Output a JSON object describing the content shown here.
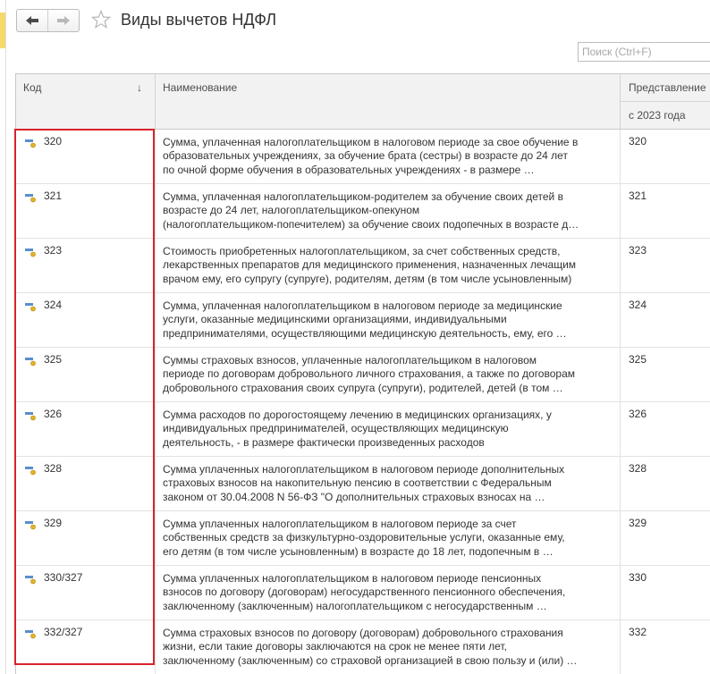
{
  "header": {
    "title": "Виды вычетов НДФЛ",
    "back_icon": "arrow-left-icon",
    "forward_icon": "arrow-right-icon",
    "favorite_icon": "star-icon"
  },
  "search": {
    "placeholder": "Поиск (Ctrl+F)",
    "value": ""
  },
  "table": {
    "columns": {
      "code": "Код",
      "name": "Наименование",
      "representation": "Представление",
      "representation_sub": "с 2023 года"
    },
    "sort_indicator": "↓",
    "rows": [
      {
        "code": "320",
        "name": "Сумма, уплаченная налогоплательщиком в налоговом периоде за свое обучение в\nобразовательных учреждениях, за обучение брата (сестры) в возрасте до 24 лет\nпо очной форме обучения в образовательных учреждениях - в размере …",
        "rep": "320"
      },
      {
        "code": "321",
        "name": "Сумма, уплаченная налогоплательщиком-родителем за обучение своих детей в\nвозрасте до 24 лет, налогоплательщиком-опекуном\n(налогоплательщиком-попечителем) за обучение своих подопечных в возрасте д…",
        "rep": "321"
      },
      {
        "code": "323",
        "name": "Стоимость приобретенных налогоплательщиком, за счет собственных средств,\nлекарственных препаратов для медицинского применения, назначенных лечащим\nврачом ему, его супругу (супруге), родителям, детям (в том числе усыновленным)",
        "rep": "323"
      },
      {
        "code": "324",
        "name": "Сумма, уплаченная налогоплательщиком в налоговом периоде за медицинские\nуслуги, оказанные медицинскими организациями, индивидуальными\nпредпринимателями, осуществляющими медицинскую деятельность, ему, его …",
        "rep": "324"
      },
      {
        "code": "325",
        "name": "Суммы страховых взносов, уплаченные налогоплательщиком в налоговом\nпериоде по договорам добровольного личного страхования, а также по договорам\nдобровольного страхования своих супруга (супруги), родителей, детей (в том …",
        "rep": "325"
      },
      {
        "code": "326",
        "name": "Сумма расходов по дорогостоящему лечению в медицинских организациях, у\nиндивидуальных предпринимателей, осуществляющих медицинскую\nдеятельность, - в размере фактически произведенных расходов",
        "rep": "326"
      },
      {
        "code": "328",
        "name": "Сумма уплаченных налогоплательщиком в налоговом периоде дополнительных\nстраховых взносов на накопительную пенсию в соответствии с Федеральным\nзаконом от 30.04.2008 N 56-ФЗ \"О дополнительных страховых взносах на …",
        "rep": "328"
      },
      {
        "code": "329",
        "name": "Сумма уплаченных налогоплательщиком в налоговом периоде за счет\nсобственных средств за физкультурно-оздоровительные услуги, оказанные ему,\nего детям (в том числе усыновленным) в возрасте до 18 лет, подопечным в …",
        "rep": "329"
      },
      {
        "code": "330/327",
        "name": "Сумма уплаченных налогоплательщиком в налоговом периоде пенсионных\nвзносов по договору (договорам) негосударственного пенсионного обеспечения,\nзаключенному (заключенным) налогоплательщиком с негосударственным …",
        "rep": "330"
      },
      {
        "code": "332/327",
        "name": "Сумма страховых взносов по договору (договорам) добровольного страхования\nжизни, если такие договоры заключаются на срок не менее пяти лет,\nзаключенному (заключенным) со страховой организацией в свою пользу и (или) …",
        "rep": "332"
      }
    ]
  },
  "colors": {
    "highlight": "#d9232b",
    "header_bg": "#f2f2f2",
    "grid": "#e2e2e2"
  }
}
